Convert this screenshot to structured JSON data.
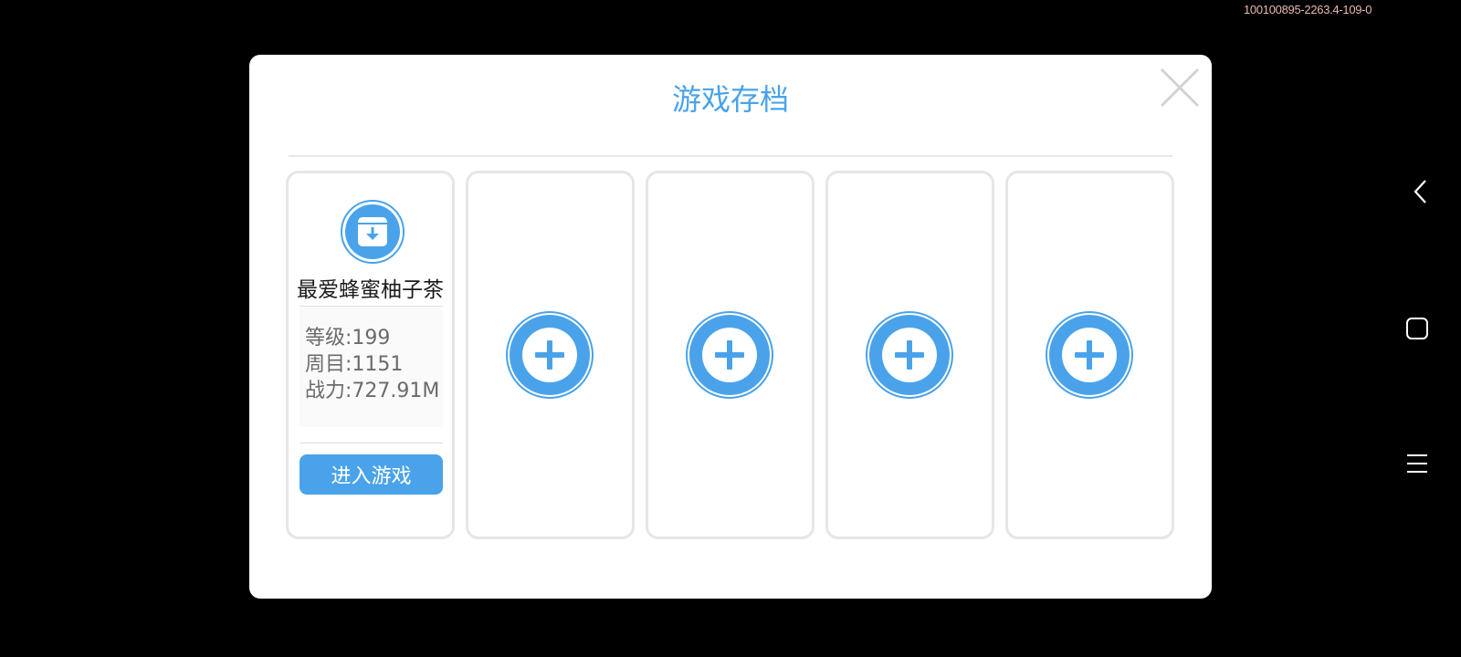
{
  "build_tag": "100100895-2263.4-109-0",
  "dialog": {
    "title": "游戏存档",
    "close_icon": "close-icon"
  },
  "slots": [
    {
      "state": "occupied",
      "icon": "save-download-icon",
      "name": "最爱蜂蜜柚子茶",
      "stats": [
        "等级:199",
        "周目:1151",
        "战力:727.91M"
      ],
      "enter_label": "进入游戏"
    },
    {
      "state": "empty",
      "icon": "plus-icon"
    },
    {
      "state": "empty",
      "icon": "plus-icon"
    },
    {
      "state": "empty",
      "icon": "plus-icon"
    },
    {
      "state": "empty",
      "icon": "plus-icon"
    }
  ],
  "nav_bar": {
    "items": [
      "back-icon",
      "home-icon",
      "menu-icon"
    ]
  },
  "colors": {
    "accent": "#4aa3ea",
    "background": "#000000",
    "dialog": "#ffffff",
    "card_border": "#e6e6e6"
  }
}
